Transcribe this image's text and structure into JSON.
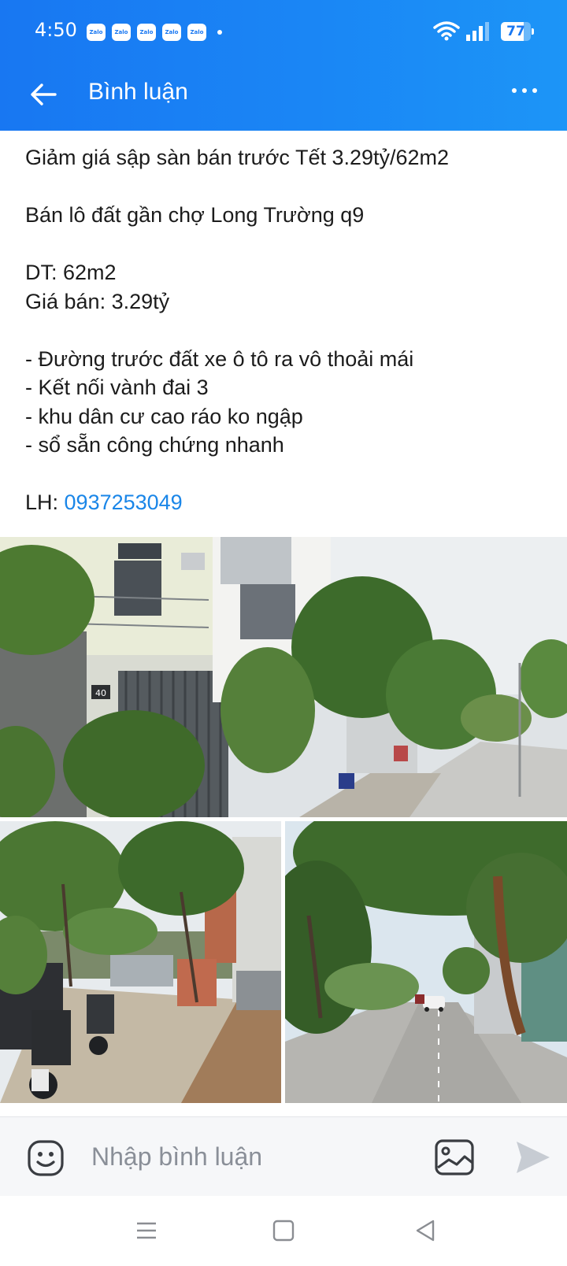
{
  "status_bar": {
    "time": "4:50",
    "notification_icons": [
      "Zalo",
      "Zalo",
      "Zalo",
      "Zalo",
      "Zalo"
    ],
    "battery_level": "77",
    "battery_fraction": 0.77
  },
  "header": {
    "title": "Bình luận",
    "back_icon": "arrow-left-icon",
    "more_icon": "more-dots-icon"
  },
  "post": {
    "lines": [
      "Giảm giá sập sàn bán trước Tết 3.29tỷ/62m2",
      "",
      "Bán lô đất gần chợ Long Trường q9",
      "",
      "DT: 62m2",
      "Giá bán: 3.29tỷ",
      "",
      "- Đường trước đất xe ô tô ra vô thoải mái",
      "- Kết nối vành đai 3",
      "- khu dân cư cao ráo ko ngập",
      "- sổ sẵn công chứng nhanh",
      ""
    ],
    "contact_label": "LH: ",
    "contact_phone": "0937253049",
    "house_number": "40"
  },
  "composer": {
    "placeholder": "Nhập bình luận",
    "emoji_icon": "emoji-icon",
    "image_icon": "image-icon",
    "send_icon": "send-icon"
  },
  "colors": {
    "accent": "#1877f2",
    "link": "#1a86e8",
    "placeholder": "#8a8f98"
  }
}
